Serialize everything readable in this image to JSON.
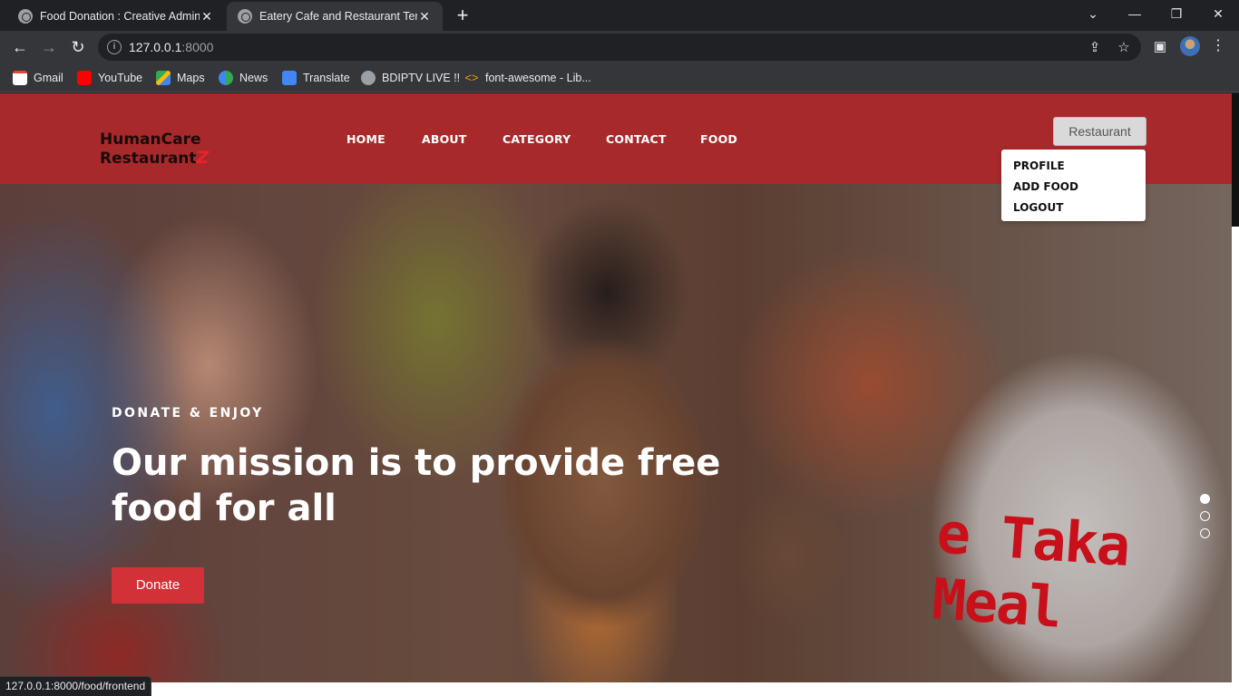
{
  "browser": {
    "tabs": [
      {
        "title": "Food Donation : Creative Admin",
        "active": false
      },
      {
        "title": "Eatery Cafe and Restaurant Temp",
        "active": true
      }
    ],
    "new_tab": "+",
    "window_controls": {
      "chevron": "⌄",
      "minimize": "—",
      "restore": "❐",
      "close": "✕"
    },
    "address": {
      "host": "127.0.0.1",
      "port": ":8000"
    },
    "bookmarks": [
      {
        "label": "Gmail",
        "icon": "gmail-icon",
        "color": "#ea4335"
      },
      {
        "label": "YouTube",
        "icon": "youtube-icon",
        "color": "#ff0000"
      },
      {
        "label": "Maps",
        "icon": "maps-icon",
        "color": "#34a853"
      },
      {
        "label": "News",
        "icon": "news-icon",
        "color": "#4285f4"
      },
      {
        "label": "Translate",
        "icon": "translate-icon",
        "color": "#4285f4"
      },
      {
        "label": "BDIPTV LIVE !!",
        "icon": "globe-icon",
        "color": "#9aa0a6"
      },
      {
        "label": "font-awesome - Lib...",
        "icon": "code-icon",
        "color": "#f29900"
      }
    ],
    "status_url": "127.0.0.1:8000/food/frontend"
  },
  "site": {
    "logo": {
      "line1": "HumanCare",
      "line2": "Restaurant",
      "mark": "Z"
    },
    "nav": [
      "HOME",
      "ABOUT",
      "CATEGORY",
      "CONTACT",
      "FOOD"
    ],
    "account_button": "Restaurant",
    "dropdown": [
      "PROFILE",
      "ADD FOOD",
      "LOGOUT"
    ],
    "brand_color": "#a8292b",
    "accent_color": "#d23237"
  },
  "hero": {
    "eyebrow": "DONATE & ENJOY",
    "headline": "Our mission is to provide free food for all",
    "cta": "Donate",
    "banner_text": "e Taka Meal",
    "slides": 3,
    "active_slide": 1
  }
}
